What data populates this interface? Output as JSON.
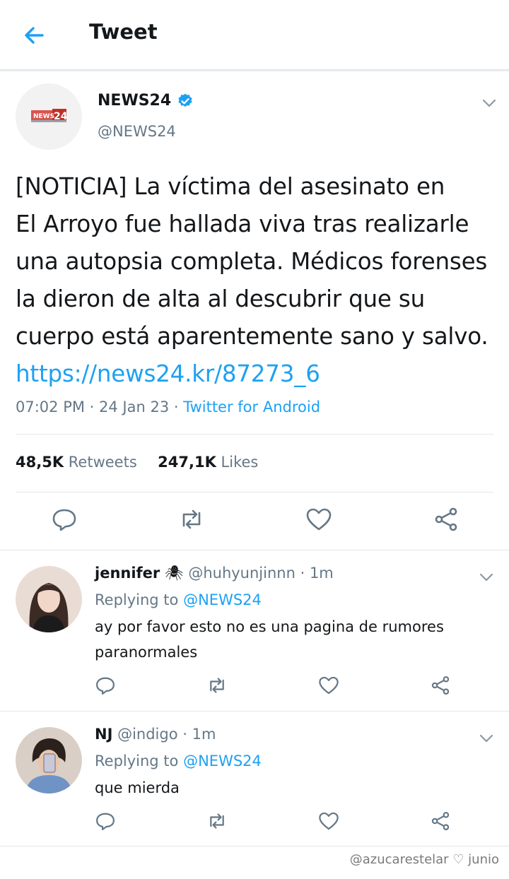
{
  "header": {
    "title": "Tweet",
    "back_icon": "arrow-left-icon"
  },
  "colors": {
    "accent": "#1da1f2",
    "text": "#14171a",
    "secondary": "#657786",
    "border": "#e1e8ed"
  },
  "tweet": {
    "author_name": "NEWS24",
    "author_handle": "@NEWS24",
    "logo_text": "NEWS 24",
    "text": "[NOTICIA] La víctima del asesinato en\nEl Arroyo fue hallada viva tras realizarle\nuna autopsia completa. Médicos forenses\nla dieron de alta al descubrir que su\ncuerpo está aparentemente sano y salvo.",
    "link": "https://news24.kr/87273_6",
    "time": "07:02 PM",
    "date": "24 Jan 23",
    "client": "Twitter for Android",
    "retweets_count": "48,5K",
    "retweets_label": "Retweets",
    "likes_count": "247,1K",
    "likes_label": "Likes"
  },
  "replies": [
    {
      "name": "jennifer",
      "emoji": "🕷",
      "handle": "@huhyunjinnn",
      "time": "1m",
      "replying_prefix": "Replying to",
      "replying_to": "@NEWS24",
      "text": "ay por favor esto no es una pagina de rumores paranormales"
    },
    {
      "name": "NJ",
      "emoji": "",
      "handle": "@indigo",
      "time": "1m",
      "replying_prefix": "Replying to",
      "replying_to": "@NEWS24",
      "text": "que mierda"
    }
  ],
  "watermark": "@azucarestelar ♡ junio"
}
